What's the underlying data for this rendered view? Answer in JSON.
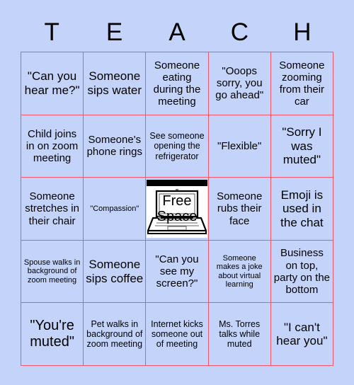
{
  "card": {
    "header_letters": [
      "T",
      "E",
      "A",
      "C",
      "H"
    ],
    "accent_border_color": "#f4556a",
    "background_color": "#c3d3f9",
    "text_color": "#000000",
    "rows": [
      [
        {
          "text": "\"Can you hear me?\"",
          "size": "fs-lg"
        },
        {
          "text": "Someone sips water",
          "size": "fs-lg"
        },
        {
          "text": "Someone eating during the meeting",
          "size": "fs-md"
        },
        {
          "text": "\"Ooops sorry, you go ahead\"",
          "size": "fs-md"
        },
        {
          "text": "Someone zooming from their car",
          "size": "fs-md"
        }
      ],
      [
        {
          "text": "Child joins in on zoom meeting",
          "size": "fs-md"
        },
        {
          "text": "Someone's phone rings",
          "size": "fs-md"
        },
        {
          "text": "See someone opening the refrigerator",
          "size": "fs-sm"
        },
        {
          "text": "\"Flexible\"",
          "size": "fs-md"
        },
        {
          "text": "\"Sorry I was muted\"",
          "size": "fs-lg"
        }
      ],
      [
        {
          "text": "Someone stretches in their chair",
          "size": "fs-md"
        },
        {
          "text": "\"Compassion\"",
          "size": "fs-xs"
        },
        {
          "text": "Free Space",
          "size": "free"
        },
        {
          "text": "Someone rubs their face",
          "size": "fs-md"
        },
        {
          "text": "Emoji is used in the chat",
          "size": "fs-lg"
        }
      ],
      [
        {
          "text": "Spouse walks in background of zoom meeting",
          "size": "fs-xs"
        },
        {
          "text": "Someone sips coffee",
          "size": "fs-lg"
        },
        {
          "text": "\"Can you see my screen?\"",
          "size": "fs-md"
        },
        {
          "text": "Someone makes a joke about virtual learning",
          "size": "fs-xs"
        },
        {
          "text": "Business on top, party on the bottom",
          "size": "fs-md"
        }
      ],
      [
        {
          "text": "\"You're muted\"",
          "size": "fs-xl"
        },
        {
          "text": "Pet walks in background of zoom meeting",
          "size": "fs-sm"
        },
        {
          "text": "Internet kicks someone out of meeting",
          "size": "fs-sm"
        },
        {
          "text": "Ms. Torres talks while muted",
          "size": "fs-sm"
        },
        {
          "text": "\"I can't hear you\"",
          "size": "fs-lg"
        }
      ]
    ],
    "free_space": {
      "label_line_1": "Free",
      "label_line_2": "Space",
      "icon": "laptop-icon"
    }
  }
}
